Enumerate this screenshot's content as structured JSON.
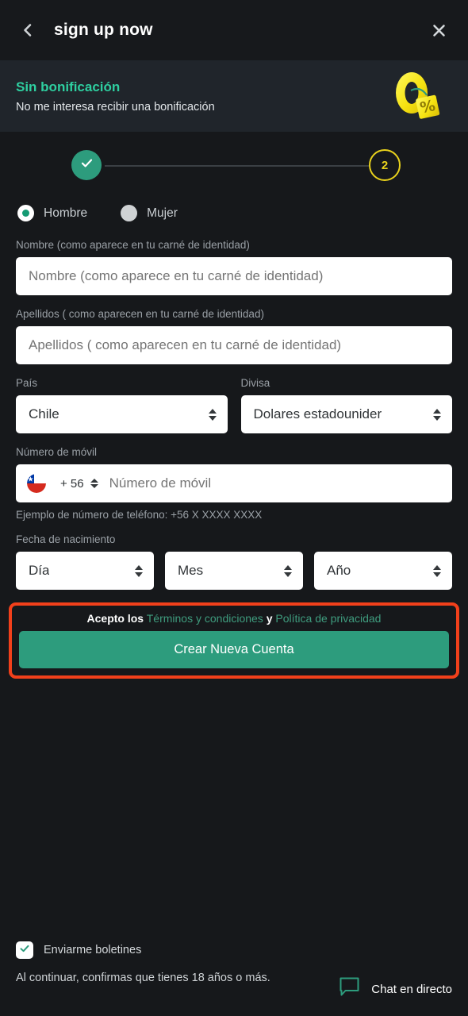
{
  "header": {
    "title": "sign up now",
    "back_icon": "chevron-left-icon",
    "close_icon": "close-icon"
  },
  "bonus": {
    "title": "Sin bonificación",
    "subtitle": "No me interesa recibir una bonificación",
    "badge_icon": "zero-percent-badge-icon",
    "badge_number": "0",
    "badge_percent": "%"
  },
  "stepper": {
    "step1_state": "completed",
    "step1_icon": "check-icon",
    "step2_label": "2"
  },
  "gender": {
    "selected": "Hombre",
    "options": [
      {
        "label": "Hombre",
        "checked": true
      },
      {
        "label": "Mujer",
        "checked": false
      }
    ]
  },
  "form": {
    "first_name": {
      "label": "Nombre (como aparece en tu carné de identidad)",
      "placeholder": "Nombre (como aparece en tu carné de identidad)",
      "value": ""
    },
    "last_name": {
      "label": "Apellidos ( como aparecen en tu carné de identidad)",
      "placeholder": "Apellidos ( como aparecen en tu carné de identidad)",
      "value": ""
    },
    "country": {
      "label": "País",
      "value": "Chile"
    },
    "currency": {
      "label": "Divisa",
      "value": "Dolares estadounider"
    },
    "mobile": {
      "label": "Número de móvil",
      "flag_icon": "chile-flag-icon",
      "dial_code": "+ 56",
      "placeholder": "Número de móvil",
      "value": "",
      "hint": "Ejemplo de número de teléfono: +56 X XXXX XXXX"
    },
    "dob": {
      "label": "Fecha de nacimiento",
      "day": "Día",
      "month": "Mes",
      "year": "Año"
    }
  },
  "cta": {
    "terms_prefix": "Acepto los",
    "terms_link": "Términos y condiciones",
    "terms_and": "y",
    "privacy_link": "Política de privacidad",
    "button_label": "Crear Nueva Cuenta",
    "highlight_color": "#f2401b"
  },
  "footer": {
    "newsletter_label": "Enviarme boletines",
    "newsletter_checked": true,
    "newsletter_icon": "check-icon",
    "age_notice": "Al continuar, confirmas que tienes 18 años o más.",
    "chat_label": "Chat en directo",
    "chat_icon": "chat-bubble-icon"
  },
  "colors": {
    "accent_green": "#2d9c7d",
    "accent_yellow": "#e9d21c",
    "page_bg": "#16181b",
    "header_bg": "#17191c",
    "banner_bg": "#20252b"
  }
}
